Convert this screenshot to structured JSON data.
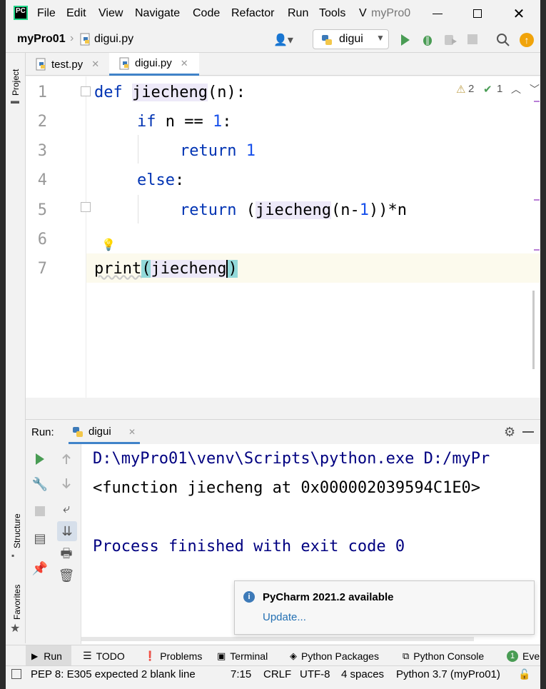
{
  "app": {
    "logo_text": "PC",
    "window_title": "myPro0"
  },
  "menu": [
    {
      "label": "File"
    },
    {
      "label": "Edit"
    },
    {
      "label": "View"
    },
    {
      "label": "Navigate"
    },
    {
      "label": "Code"
    },
    {
      "label": "Refactor"
    },
    {
      "label": "Run"
    },
    {
      "label": "Tools"
    },
    {
      "label": "V"
    }
  ],
  "breadcrumb": {
    "project": "myPro01",
    "file": "digui.py"
  },
  "run_config": {
    "label": "digui"
  },
  "tabs": [
    {
      "label": "test.py",
      "active": false
    },
    {
      "label": "digui.py",
      "active": true
    }
  ],
  "left_stripe": {
    "project": "Project",
    "structure": "Structure",
    "favorites": "Favorites"
  },
  "editor": {
    "line_numbers": [
      "1",
      "2",
      "3",
      "4",
      "5",
      "6",
      "7"
    ],
    "inspection": {
      "warnings": "2",
      "ok": "1"
    },
    "lines": {
      "l1_kw": "def",
      "l1_fn": "jiecheng",
      "l1_rest": "(n):",
      "l2_kw": "if",
      "l2_mid": " n == ",
      "l2_num": "1",
      "l2_end": ":",
      "l3_kw": "return",
      "l3_num": "1",
      "l4_kw": "else",
      "l4_end": ":",
      "l5_kw": "return",
      "l5_open": " (",
      "l5_fn": "jiecheng",
      "l5_mid": "(n-",
      "l5_num": "1",
      "l5_end": "))*n",
      "l7_print": "print",
      "l7_open": "(",
      "l7_fn": "jiecheng",
      "l7_close": ")"
    }
  },
  "run_panel": {
    "label": "Run:",
    "tab": "digui",
    "console": [
      "D:\\myPro01\\venv\\Scripts\\python.exe D:/myPr",
      "<function jiecheng at 0x000002039594C1E0>",
      "",
      "Process finished with exit code 0"
    ]
  },
  "notification": {
    "title": "PyCharm 2021.2 available",
    "link": "Update..."
  },
  "bottom_tools": [
    {
      "label": "Run"
    },
    {
      "label": "TODO"
    },
    {
      "label": "Problems"
    },
    {
      "label": "Terminal"
    },
    {
      "label": "Python Packages"
    },
    {
      "label": "Python Console"
    },
    {
      "label": "Even"
    }
  ],
  "status": {
    "message": "PEP 8: E305 expected 2 blank line",
    "position": "7:15",
    "line_sep": "CRLF",
    "encoding": "UTF-8",
    "indent": "4 spaces",
    "interpreter": "Python 3.7 (myPro01)"
  },
  "colors": {
    "accent": "#4083c9",
    "keyword": "#0033b3",
    "number": "#1750eb",
    "run_green": "#499c54",
    "update_orange": "#f0a30a"
  }
}
